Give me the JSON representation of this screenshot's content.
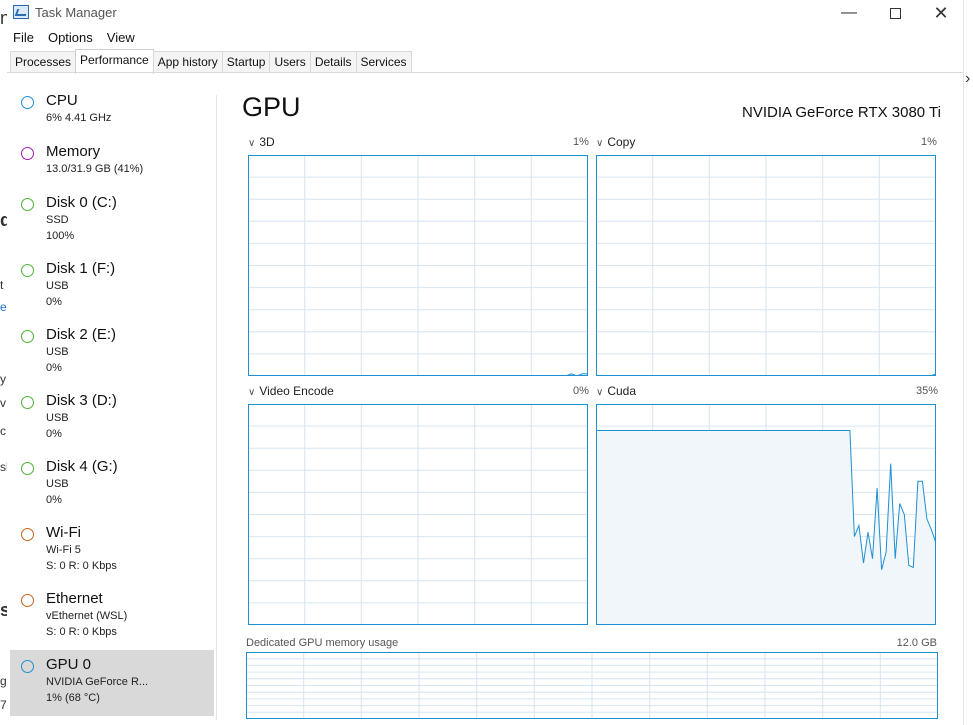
{
  "window": {
    "title": "Task Manager"
  },
  "menu": [
    "File",
    "Options",
    "View"
  ],
  "tabs": [
    {
      "label": "Processes",
      "active": false
    },
    {
      "label": "Performance",
      "active": true
    },
    {
      "label": "App history",
      "active": false
    },
    {
      "label": "Startup",
      "active": false
    },
    {
      "label": "Users",
      "active": false
    },
    {
      "label": "Details",
      "active": false
    },
    {
      "label": "Services",
      "active": false
    }
  ],
  "sidebar": [
    {
      "name": "CPU",
      "line1": "6%  4.41 GHz",
      "line2": "",
      "color": "#1e90d2",
      "selected": false
    },
    {
      "name": "Memory",
      "line1": "13.0/31.9 GB (41%)",
      "line2": "",
      "color": "#9a1fb0",
      "selected": false
    },
    {
      "name": "Disk 0 (C:)",
      "line1": "SSD",
      "line2": "100%",
      "color": "#4db336",
      "selected": false
    },
    {
      "name": "Disk 1 (F:)",
      "line1": "USB",
      "line2": "0%",
      "color": "#4db336",
      "selected": false
    },
    {
      "name": "Disk 2 (E:)",
      "line1": "USB",
      "line2": "0%",
      "color": "#4db336",
      "selected": false
    },
    {
      "name": "Disk 3 (D:)",
      "line1": "USB",
      "line2": "0%",
      "color": "#4db336",
      "selected": false
    },
    {
      "name": "Disk 4 (G:)",
      "line1": "USB",
      "line2": "0%",
      "color": "#4db336",
      "selected": false
    },
    {
      "name": "Wi-Fi",
      "line1": "Wi-Fi 5",
      "line2": "S: 0  R: 0 Kbps",
      "color": "#c8641e",
      "selected": false
    },
    {
      "name": "Ethernet",
      "line1": "vEthernet (WSL)",
      "line2": "S: 0  R: 0 Kbps",
      "color": "#c8641e",
      "selected": false
    },
    {
      "name": "GPU 0",
      "line1": "NVIDIA GeForce R...",
      "line2": "1% (68 °C)",
      "color": "#1e90d2",
      "selected": true
    }
  ],
  "main": {
    "title": "GPU",
    "device": "NVIDIA GeForce RTX 3080 Ti",
    "engines": [
      {
        "label": "3D",
        "percent": "1%",
        "values": [
          0,
          0,
          0,
          0,
          0,
          0,
          0,
          0,
          0,
          0,
          0,
          0,
          0,
          0,
          0,
          0,
          0,
          0,
          0,
          0,
          0,
          0,
          0,
          0,
          0,
          0,
          0,
          0,
          0,
          0,
          0,
          0,
          0,
          0,
          0,
          0,
          0,
          0,
          0,
          0,
          0,
          0,
          0,
          0,
          0,
          0,
          0,
          0,
          0,
          0,
          0,
          0,
          0,
          0,
          0,
          0,
          0,
          0,
          1,
          0,
          1,
          1
        ]
      },
      {
        "label": "Copy",
        "percent": "1%",
        "values": [
          0,
          0,
          0,
          0,
          0,
          0,
          0,
          0,
          0,
          0,
          0,
          0,
          0,
          0,
          0,
          0,
          0,
          0,
          0,
          0,
          0,
          0,
          0,
          0,
          0,
          0,
          0,
          0,
          0,
          0,
          0,
          0,
          0,
          0,
          0,
          0,
          0,
          0,
          0,
          0,
          0,
          0,
          0,
          0,
          0,
          0,
          0,
          0,
          0,
          0,
          0,
          0,
          0,
          0,
          0,
          0,
          0,
          0,
          0,
          0,
          0,
          1
        ]
      },
      {
        "label": "Video Encode",
        "percent": "0%",
        "values": [
          0,
          0,
          0,
          0,
          0,
          0,
          0,
          0,
          0,
          0,
          0,
          0,
          0,
          0,
          0,
          0,
          0,
          0,
          0,
          0,
          0,
          0,
          0,
          0,
          0,
          0,
          0,
          0,
          0,
          0,
          0,
          0,
          0,
          0,
          0,
          0,
          0,
          0,
          0,
          0,
          0,
          0,
          0,
          0,
          0,
          0,
          0,
          0,
          0,
          0,
          0,
          0,
          0,
          0,
          0,
          0,
          0,
          0,
          0,
          0,
          0,
          0
        ]
      },
      {
        "label": "Cuda",
        "percent": "35%",
        "values": [
          88,
          88,
          88,
          88,
          88,
          88,
          88,
          88,
          88,
          88,
          88,
          88,
          88,
          88,
          88,
          88,
          88,
          88,
          88,
          88,
          88,
          88,
          88,
          88,
          88,
          88,
          88,
          88,
          88,
          88,
          88,
          88,
          88,
          88,
          88,
          88,
          88,
          88,
          88,
          88,
          88,
          88,
          88,
          88,
          88,
          88,
          88,
          88,
          88,
          88,
          88,
          88,
          88,
          88,
          88,
          88,
          88,
          40,
          45,
          28,
          42,
          30,
          62,
          25,
          33,
          73,
          30,
          55,
          50,
          27,
          26,
          65,
          65,
          48,
          43,
          37
        ]
      }
    ],
    "memory": {
      "label": "Dedicated GPU memory usage",
      "max": "12.0 GB"
    }
  },
  "colors": {
    "accent": "#1e90d2",
    "grid": "#d6e6f2",
    "fill": "#f1f6fa"
  }
}
